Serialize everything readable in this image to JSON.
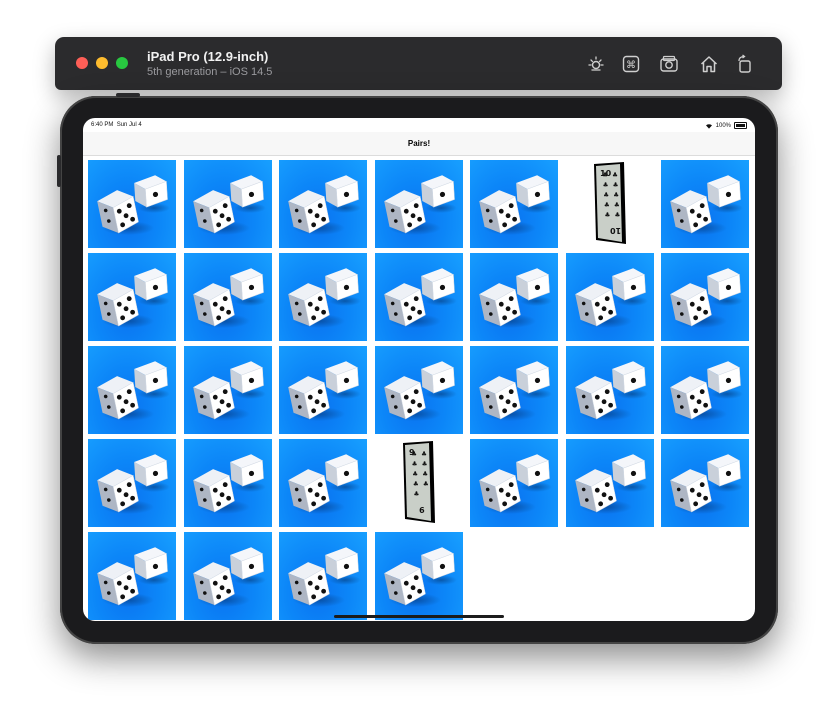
{
  "simulator": {
    "device_name": "iPad Pro (12.9-inch)",
    "device_subtitle": "5th generation – iOS 14.5",
    "toolbar_icons": [
      "brightness-icon",
      "command-icon",
      "screenshot-icon",
      "home-icon",
      "rotate-icon"
    ]
  },
  "status_bar": {
    "time": "6:40 PM",
    "date": "Sun Jul 4",
    "battery": "100%"
  },
  "nav": {
    "title": "Pairs!"
  },
  "grid": {
    "columns": 7,
    "tiles": [
      {
        "state": "back"
      },
      {
        "state": "back"
      },
      {
        "state": "back"
      },
      {
        "state": "back"
      },
      {
        "state": "back"
      },
      {
        "state": "face",
        "rank": "10",
        "suit": "clubs"
      },
      {
        "state": "back"
      },
      {
        "state": "back"
      },
      {
        "state": "back"
      },
      {
        "state": "back"
      },
      {
        "state": "back"
      },
      {
        "state": "back"
      },
      {
        "state": "back"
      },
      {
        "state": "back"
      },
      {
        "state": "back"
      },
      {
        "state": "back"
      },
      {
        "state": "back"
      },
      {
        "state": "back"
      },
      {
        "state": "back"
      },
      {
        "state": "back"
      },
      {
        "state": "back"
      },
      {
        "state": "back"
      },
      {
        "state": "back"
      },
      {
        "state": "back"
      },
      {
        "state": "face",
        "rank": "9",
        "suit": "clubs"
      },
      {
        "state": "back"
      },
      {
        "state": "back"
      },
      {
        "state": "back"
      },
      {
        "state": "back"
      },
      {
        "state": "back"
      },
      {
        "state": "back"
      },
      {
        "state": "back"
      }
    ]
  },
  "colors": {
    "tile_back": "#0c86f8",
    "card_edge": "#000000"
  }
}
